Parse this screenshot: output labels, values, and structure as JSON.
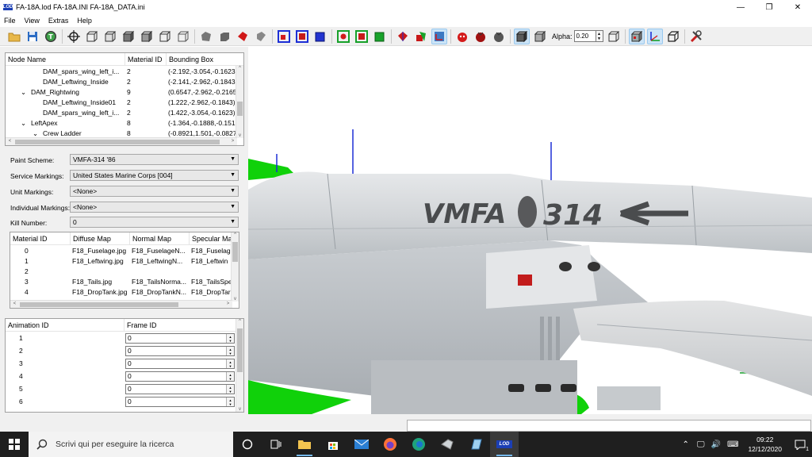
{
  "window": {
    "title": "FA-18A.lod  FA-18A.INI  FA-18A_DATA.ini",
    "logo_text": "LOD",
    "minimize": "—",
    "maximize": "❐",
    "close": "✕"
  },
  "menu": [
    "File",
    "View",
    "Extras",
    "Help"
  ],
  "toolbar": {
    "alpha_label": "Alpha:",
    "alpha_value": "0.20",
    "spin_up": "▲",
    "spin_down": "▼"
  },
  "node_tree": {
    "columns": [
      "Node Name",
      "Material ID",
      "Bounding Box"
    ],
    "rows": [
      {
        "expander": "",
        "indent": 3,
        "name": "DAM_spars_wing_left_i...",
        "material": "2",
        "bbox": "(-2.192,-3.054,-0.1623"
      },
      {
        "expander": "",
        "indent": 3,
        "name": "DAM_Leftwing_Inside",
        "material": "2",
        "bbox": "(-2.141,-2.962,-0.1843"
      },
      {
        "expander": "⌄",
        "indent": 2,
        "name": "DAM_Rightwing",
        "material": "9",
        "bbox": "(0.6547,-2.962,-0.2165"
      },
      {
        "expander": "",
        "indent": 3,
        "name": "DAM_Leftwing_Inside01",
        "material": "2",
        "bbox": "(1.222,-2.962,-0.1843)"
      },
      {
        "expander": "",
        "indent": 3,
        "name": "DAM_spars_wing_left_i...",
        "material": "2",
        "bbox": "(1.422,-3.054,-0.1623)"
      },
      {
        "expander": "⌄",
        "indent": 2,
        "name": "LeftApex",
        "material": "8",
        "bbox": "(-1.364,-0.1888,-0.151"
      },
      {
        "expander": "⌄",
        "indent": 3,
        "name": "Crew Ladder",
        "material": "8",
        "bbox": "(-0.8921,1.501,-0.0827"
      }
    ],
    "scroll_left": "<",
    "scroll_right": ">",
    "scroll_up": "^",
    "scroll_down": "v"
  },
  "properties": [
    {
      "label": "Paint Scheme:",
      "value": "VMFA-314 '86"
    },
    {
      "label": "Service Markings:",
      "value": "United States Marine Corps [004]"
    },
    {
      "label": "Unit Markings:",
      "value": "<None>"
    },
    {
      "label": "Individual Markings:",
      "value": "<None>"
    },
    {
      "label": "Kill Number:",
      "value": "0"
    }
  ],
  "combo_arrow": "▼",
  "materials": {
    "columns": [
      "Material ID",
      "Diffuse Map",
      "Normal Map",
      "Specular Ma"
    ],
    "rows": [
      {
        "id": "0",
        "diffuse": "F18_Fuselage.jpg",
        "normal": "F18_FuselageN...",
        "specular": "F18_Fuselag"
      },
      {
        "id": "1",
        "diffuse": "F18_Leftwing.jpg",
        "normal": "F18_LeftwingN...",
        "specular": "F18_Leftwin"
      },
      {
        "id": "2",
        "diffuse": "",
        "normal": "",
        "specular": ""
      },
      {
        "id": "3",
        "diffuse": "F18_Tails.jpg",
        "normal": "F18_TailsNorma...",
        "specular": "F18_TailsSpe"
      },
      {
        "id": "4",
        "diffuse": "F18_DropTank.jpg",
        "normal": "F18_DropTankN...",
        "specular": "F18_DropTar"
      }
    ]
  },
  "animations": {
    "columns": [
      "Animation ID",
      "Frame ID"
    ],
    "rows": [
      {
        "id": "1",
        "frame": "0"
      },
      {
        "id": "2",
        "frame": "0"
      },
      {
        "id": "3",
        "frame": "0"
      },
      {
        "id": "4",
        "frame": "0"
      },
      {
        "id": "5",
        "frame": "0"
      },
      {
        "id": "6",
        "frame": "0"
      }
    ]
  },
  "viewport": {
    "fuselage_text": "VMFA",
    "fuselage_number": "314"
  },
  "taskbar": {
    "search_placeholder": "Scrivi qui per eseguire la ricerca",
    "time": "09:22",
    "date": "12/12/2020",
    "notification_count": "1",
    "lod_app_label": "LOD"
  }
}
